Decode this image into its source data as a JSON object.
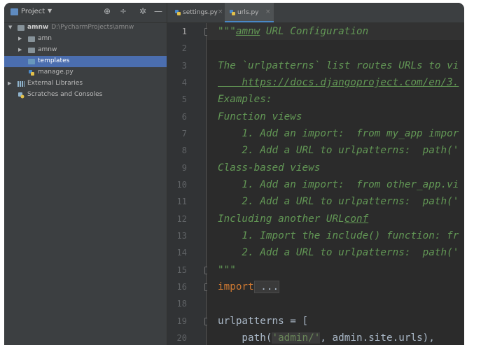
{
  "project_panel": {
    "title": "Project",
    "tree": [
      {
        "label": "amnw",
        "path": "D:\\PycharmProjects\\amnw",
        "icon": "folder-icon",
        "arrow": "▼"
      },
      {
        "label": "amn",
        "icon": "folder-icon",
        "arrow": "▶"
      },
      {
        "label": "amnw",
        "icon": "folder-icon",
        "arrow": "▶"
      },
      {
        "label": "templates",
        "icon": "folder-icon",
        "selected": true
      },
      {
        "label": "manage.py",
        "icon": "python-file-icon"
      },
      {
        "label": "External Libraries",
        "icon": "library-icon",
        "arrow": "▶"
      },
      {
        "label": "Scratches and Consoles",
        "icon": "scratches-icon"
      }
    ]
  },
  "editor": {
    "tabs": [
      {
        "label": "settings.py",
        "active": false
      },
      {
        "label": "urls.py",
        "active": true
      }
    ],
    "line_numbers": [
      "1",
      "2",
      "3",
      "4",
      "5",
      "6",
      "7",
      "8",
      "9",
      "10",
      "11",
      "12",
      "13",
      "14",
      "15",
      "16",
      "18",
      "19",
      "20"
    ],
    "code": {
      "l1_quotes": "\"\"\"",
      "l1_name": "amnw",
      "l1_rest": " URL Configuration",
      "l3": "The `urlpatterns` list routes URLs to vi",
      "l4": "    https://docs.djangoproject.com/en/3.",
      "l5": "Examples:",
      "l6": "Function views",
      "l7": "    1. Add an import:  from my_app impor",
      "l8": "    2. Add a URL to urlpatterns:  path('",
      "l9": "Class-based views",
      "l10": "    1. Add an import:  from other_app.vi",
      "l11": "    2. Add a URL to urlpatterns:  path('",
      "l12_a": "Including another URL",
      "l12_b": "conf",
      "l13": "    1. Import the include() function: fr",
      "l14": "    2. Add a URL to urlpatterns:  path('",
      "l15": "\"\"\"",
      "l16_kw": "import",
      "l16_rest": " ...",
      "l19": "urlpatterns = [",
      "l20_a": "    path(",
      "l20_str": "'admin/'",
      "l20_b": ", admin.site.urls),"
    }
  },
  "colors": {
    "docstring": "#629755",
    "keyword": "#cc7832",
    "string": "#6a8759",
    "text": "#a9b7c6",
    "selection": "#4b6eaf"
  }
}
